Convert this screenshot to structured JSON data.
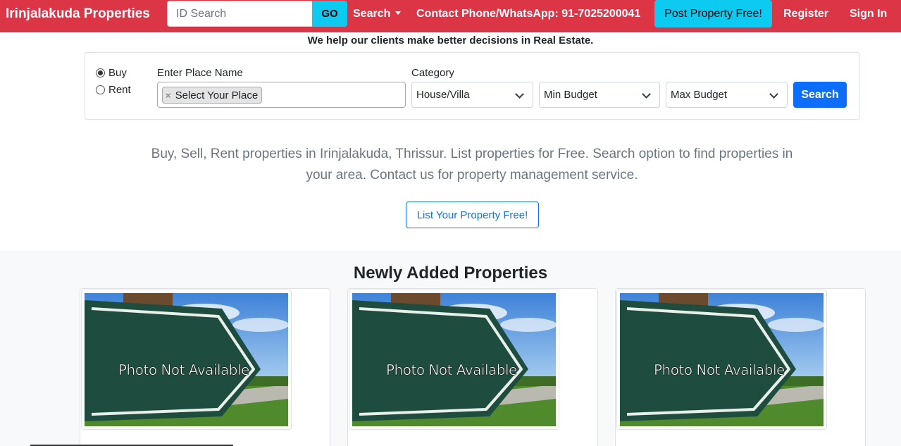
{
  "navbar": {
    "brand": "Irinjalakuda Properties",
    "id_search_placeholder": "ID Search",
    "go_label": "GO",
    "search_label": "Search",
    "contact_label": "Contact Phone/WhatsApp: 91-7025200041",
    "post_label": "Post Property Free!",
    "register_label": "Register",
    "signin_label": "Sign In",
    "bg_color": "#dc3545",
    "accent_color": "#0dcaf0"
  },
  "tagline": "We help our clients make better decisions in Real Estate.",
  "search_form": {
    "radio_buy": "Buy",
    "radio_rent": "Rent",
    "selected_mode": "Buy",
    "place_label": "Enter Place Name",
    "place_tag": "Select Your Place",
    "category_label": "Category",
    "category_value": "House/Villa",
    "min_budget": "Min Budget",
    "max_budget": "Max Budget",
    "search_button": "Search"
  },
  "lead_text": "Buy, Sell, Rent properties in Irinjalakuda, Thrissur. List properties for Free. Search option to find properties in your area. Contact us for property management service.",
  "list_button": "List Your Property Free!",
  "newly_added": {
    "title": "Newly Added Properties",
    "cards": [
      {
        "image_text": "Photo Not Available"
      },
      {
        "image_text": "Photo Not Available"
      },
      {
        "image_text": "Photo Not Available"
      }
    ]
  }
}
